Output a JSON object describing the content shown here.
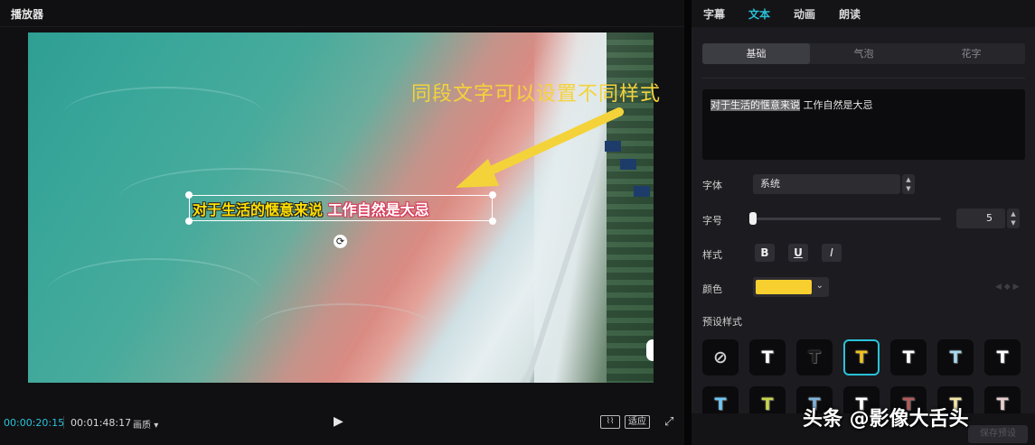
{
  "player": {
    "title": "播放器",
    "annotation": "同段文字可以设置不同样式",
    "subtitle_part1": "对于生活的惬意来说",
    "subtitle_part2": "工作自然是大忌",
    "current_time": "00:00:20:15",
    "duration": "00:01:48:17",
    "quality_label": "画质",
    "fit_label": "适应"
  },
  "panel": {
    "tabs": [
      {
        "label": "字幕"
      },
      {
        "label": "文本",
        "active": true
      },
      {
        "label": "动画"
      },
      {
        "label": "朗读"
      }
    ],
    "sub_tabs": [
      {
        "label": "基础",
        "active": true
      },
      {
        "label": "气泡"
      },
      {
        "label": "花字"
      }
    ],
    "text_value_highlighted": "对于生活的惬意来说",
    "text_value_rest": " 工作自然是大忌",
    "font_label": "字体",
    "font_value": "系统",
    "size_label": "字号",
    "size_value": "5",
    "style_label": "样式",
    "bold_label": "B",
    "underline_label": "U",
    "italic_label": "I",
    "color_label": "颜色",
    "color_value": "#f7cf2f",
    "preset_label": "预设样式",
    "apply_label": "保存预设"
  },
  "presets": [
    {
      "glyph": "⊘",
      "color": "#cfcfcf",
      "selected": false
    },
    {
      "glyph": "T",
      "color": "#ffffff",
      "selected": false
    },
    {
      "glyph": "T",
      "color": "#1a1a1a",
      "selected": false
    },
    {
      "glyph": "T",
      "color": "#f2c21b",
      "selected": true
    },
    {
      "glyph": "T",
      "color": "#ffffff",
      "selected": false
    },
    {
      "glyph": "T",
      "color": "#a8d8f0",
      "selected": false
    },
    {
      "glyph": "T",
      "color": "#ffffff",
      "selected": false
    },
    {
      "glyph": "T",
      "color": "#6ec6f5",
      "selected": false
    },
    {
      "glyph": "T",
      "color": "#c9d64a",
      "selected": false
    },
    {
      "glyph": "T",
      "color": "#7fb3d9",
      "selected": false
    },
    {
      "glyph": "T",
      "color": "#ffffff",
      "selected": false
    },
    {
      "glyph": "T",
      "color": "#b35a5a",
      "selected": false
    },
    {
      "glyph": "T",
      "color": "#f3e6a8",
      "selected": false
    },
    {
      "glyph": "T",
      "color": "#e8d0d0",
      "selected": false
    }
  ],
  "watermark": "头条 @影像大舌头",
  "colors": {
    "accent": "#29c2d8",
    "annotation": "#f4d33a",
    "subtitle_yellow": "#ffe000",
    "subtitle_red": "#d83a5a"
  }
}
